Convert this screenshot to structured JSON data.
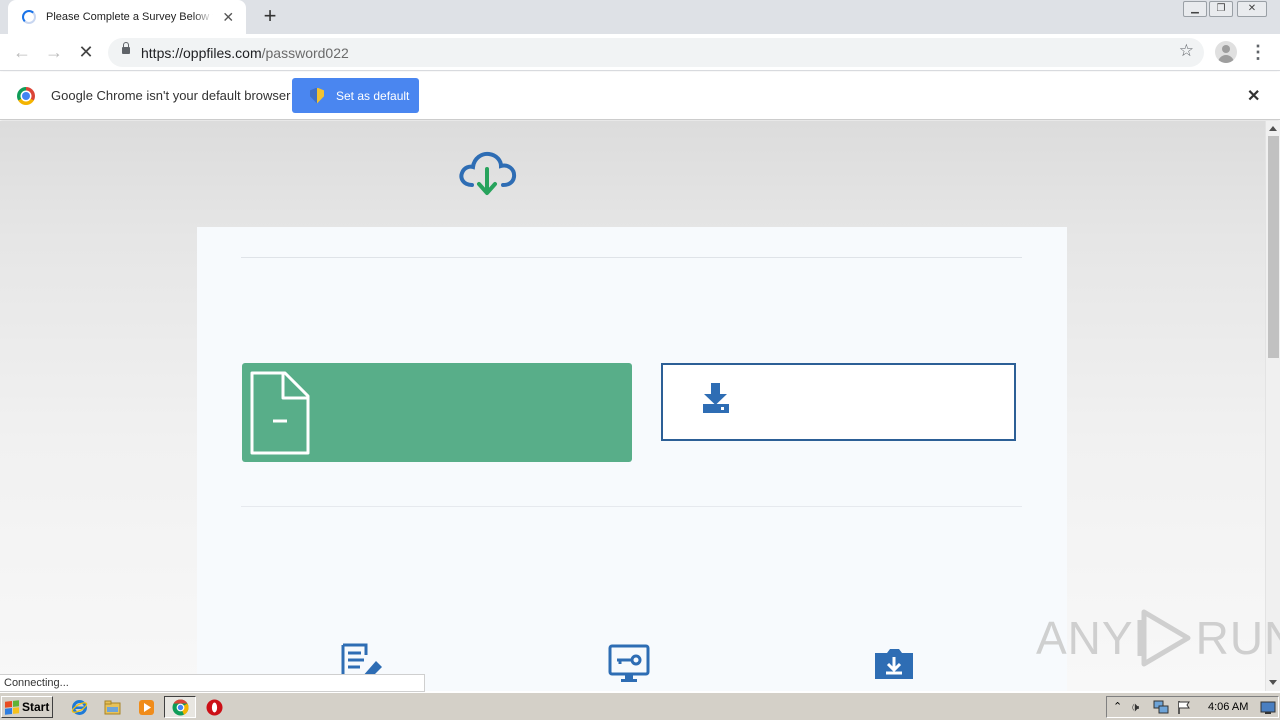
{
  "browser": {
    "tab_title": "Please Complete a Survey Below to Continue",
    "url_host": "https://oppfiles.com",
    "url_path": "/password022"
  },
  "infobar": {
    "message": "Google Chrome isn't your default browser",
    "button_label": "Set as default"
  },
  "status_text": "Connecting...",
  "watermark": {
    "left": "ANY",
    "right": "RUN"
  },
  "taskbar": {
    "start_label": "Start",
    "clock": "4:06 AM"
  },
  "colors": {
    "green_box": "#58ae89",
    "icon_blue": "#2e6db4",
    "arrow_green": "#27a35c"
  },
  "icons": [
    "cloud-download-icon",
    "document-icon",
    "download-tray-icon",
    "edit-document-icon",
    "monitor-key-icon",
    "folder-download-icon"
  ]
}
